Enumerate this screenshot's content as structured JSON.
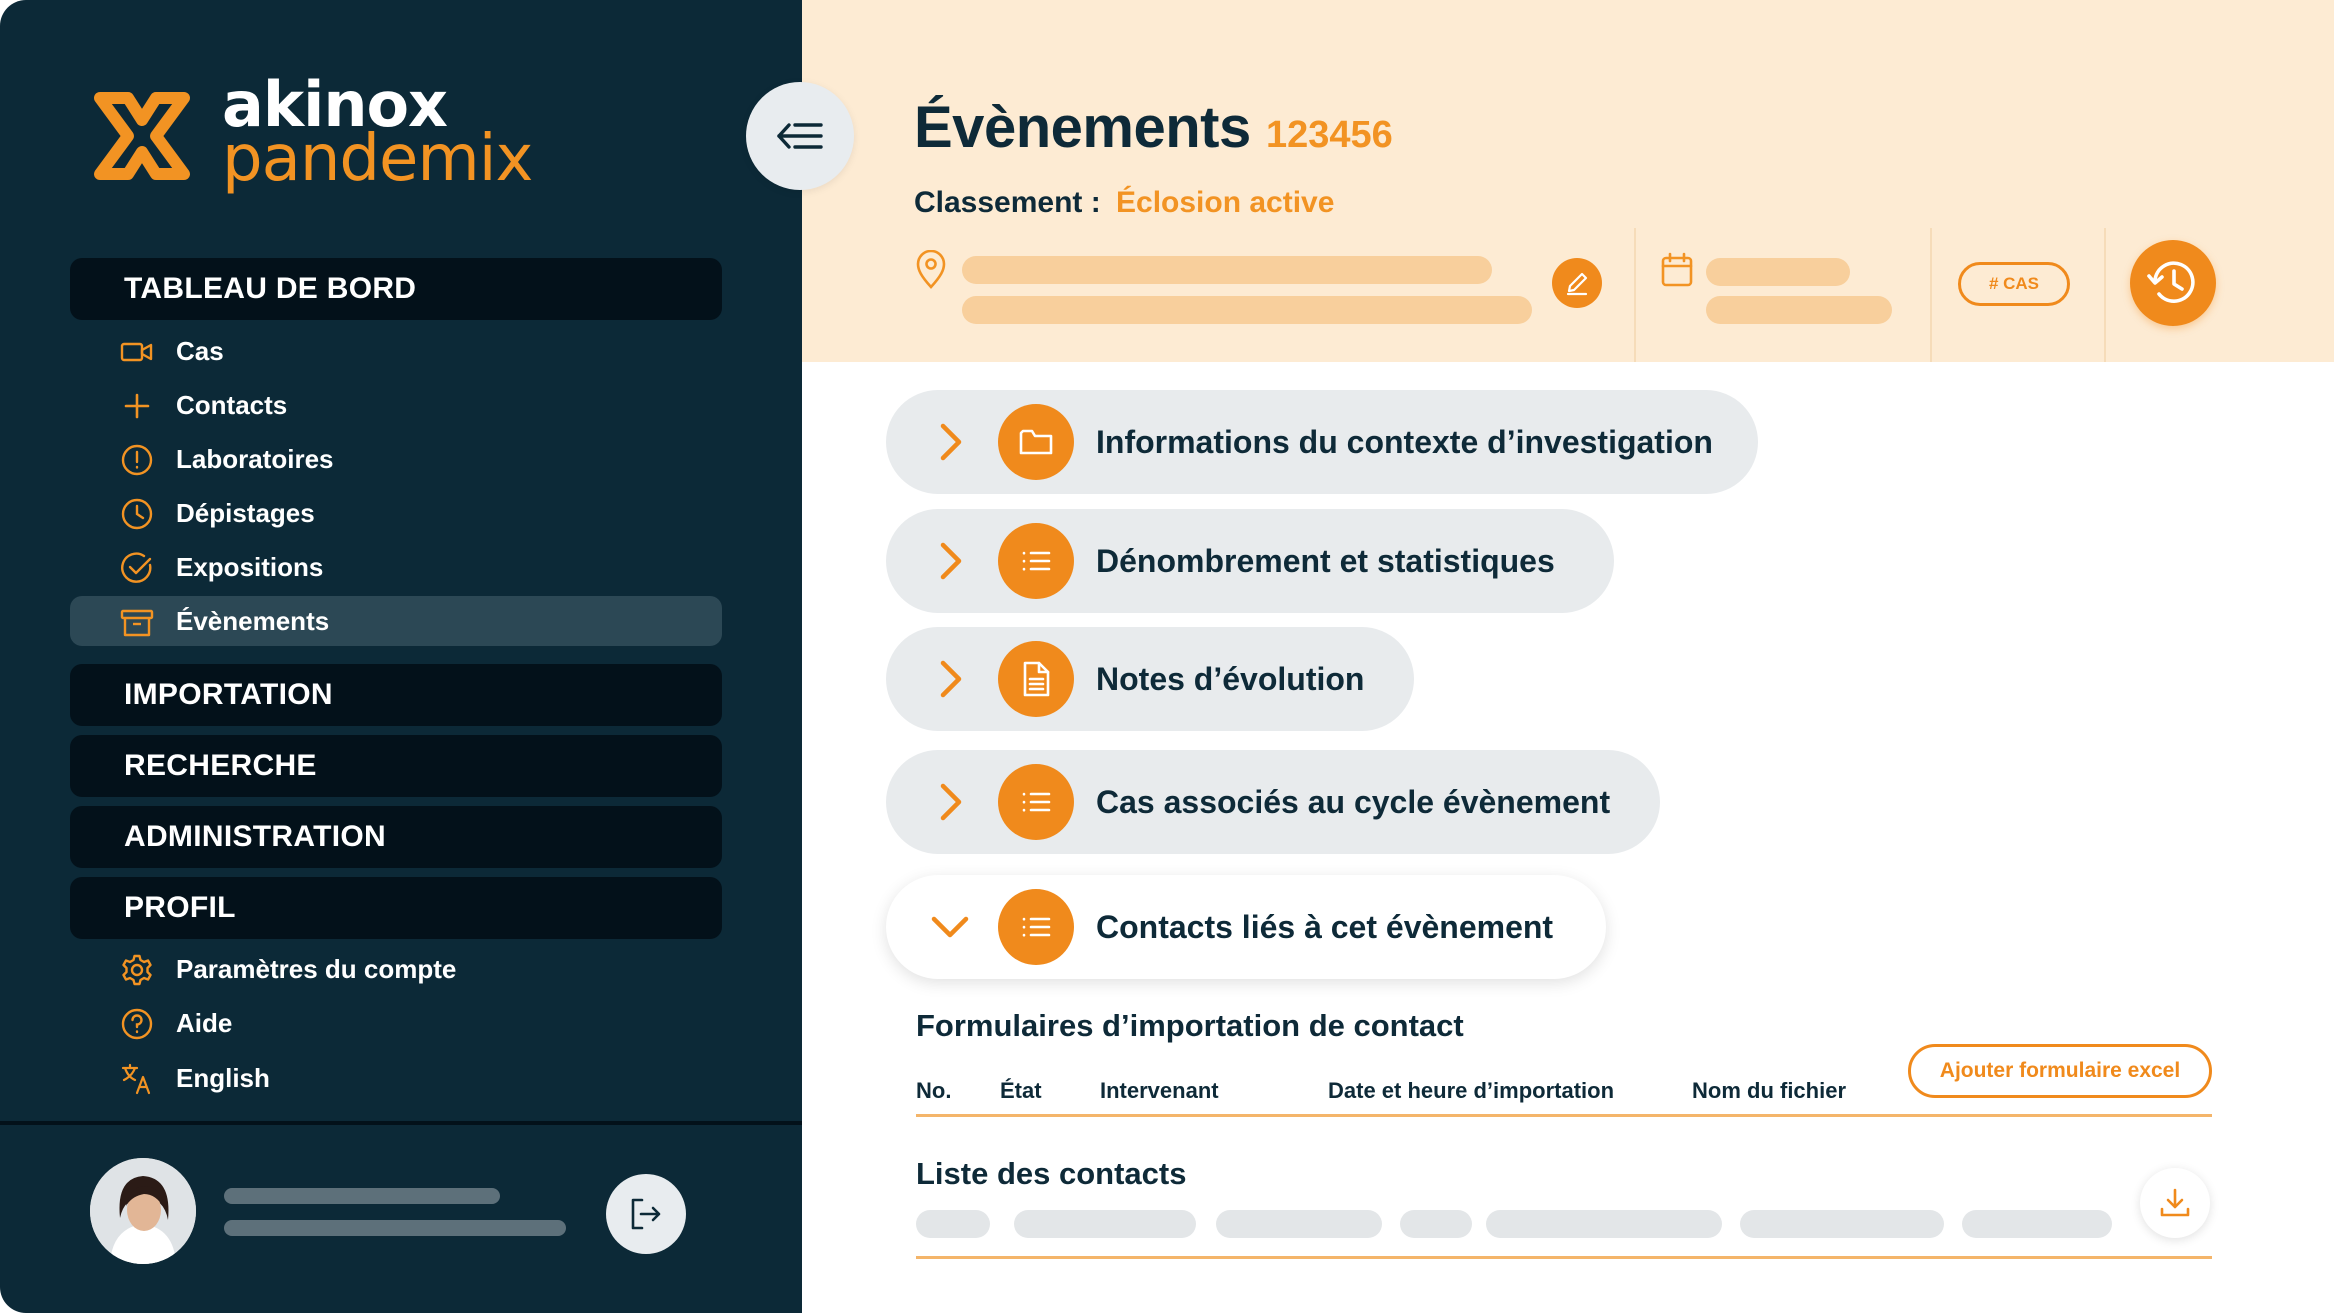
{
  "brand": {
    "line1": "akinox",
    "line2": "pandemix"
  },
  "sidebar": {
    "sections": {
      "dashboard": "TABLEAU DE BORD",
      "import": "IMPORTATION",
      "search": "RECHERCHE",
      "admin": "ADMINISTRATION",
      "profile": "PROFIL"
    },
    "items": [
      {
        "label": "Cas",
        "icon": "video-camera-icon"
      },
      {
        "label": "Contacts",
        "icon": "plus-icon"
      },
      {
        "label": "Laboratoires",
        "icon": "alert-circle-icon"
      },
      {
        "label": "Dépistages",
        "icon": "clock-icon"
      },
      {
        "label": "Expositions",
        "icon": "check-circle-icon"
      },
      {
        "label": "Évènements",
        "icon": "archive-box-icon",
        "active": true
      }
    ],
    "profile_items": [
      {
        "label": "Paramètres du compte",
        "icon": "gear-icon"
      },
      {
        "label": "Aide",
        "icon": "question-circle-icon"
      },
      {
        "label": "English",
        "icon": "translate-icon"
      }
    ]
  },
  "header": {
    "title": "Évènements",
    "id": "123456",
    "classement_label": "Classement :",
    "classement_value": "Éclosion active",
    "cas_badge": "# CAS"
  },
  "accordion": [
    {
      "label": "Informations du contexte d’investigation",
      "icon": "folder-icon",
      "open": false
    },
    {
      "label": "Dénombrement et statistiques",
      "icon": "list-icon",
      "open": false
    },
    {
      "label": "Notes d’évolution",
      "icon": "document-icon",
      "open": false
    },
    {
      "label": "Cas associés au cycle évènement",
      "icon": "list-icon",
      "open": false
    },
    {
      "label": "Contacts liés à cet évènement",
      "icon": "list-icon",
      "open": true
    }
  ],
  "import_forms": {
    "title": "Formulaires d’importation de contact",
    "columns": [
      "No.",
      "État",
      "Intervenant",
      "Date et heure d’importation",
      "Nom du fichier"
    ],
    "add_button": "Ajouter formulaire excel"
  },
  "contacts_list": {
    "title": "Liste des contacts"
  },
  "colors": {
    "navy": "#0c2937",
    "accent": "#f08a1c",
    "header_bg": "#fdebd3"
  }
}
